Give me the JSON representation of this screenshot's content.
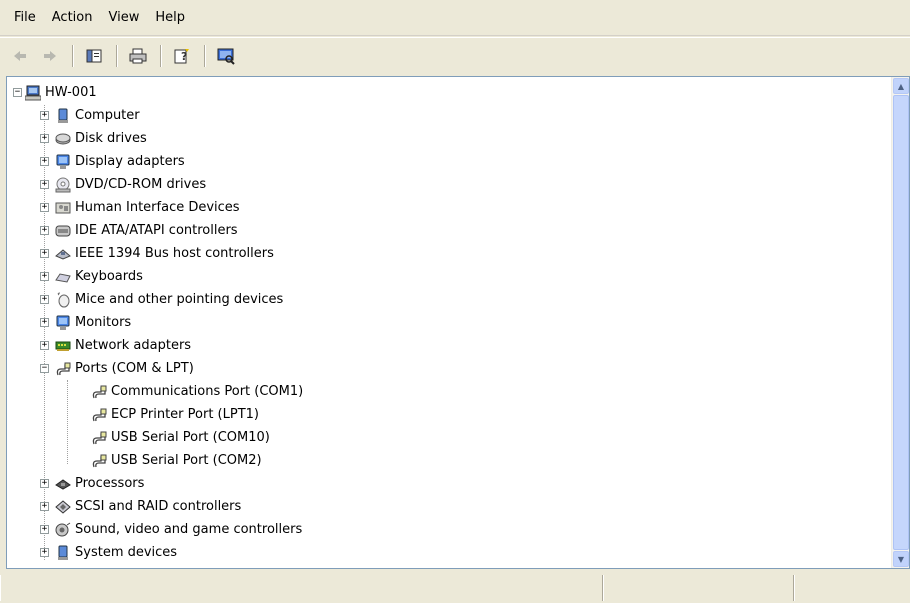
{
  "menubar": {
    "items": [
      {
        "label": "File"
      },
      {
        "label": "Action"
      },
      {
        "label": "View"
      },
      {
        "label": "Help"
      }
    ]
  },
  "toolbar": {
    "buttons": [
      "back-arrow-icon",
      "forward-arrow-icon",
      "show-hide-console-tree-icon",
      "print-icon",
      "properties-help-icon",
      "scan-hardware-icon"
    ]
  },
  "tree": {
    "root": {
      "label": "HW-001",
      "expander": "−"
    },
    "items": [
      {
        "label": "Computer",
        "expander": "+"
      },
      {
        "label": "Disk drives",
        "expander": "+"
      },
      {
        "label": "Display adapters",
        "expander": "+"
      },
      {
        "label": "DVD/CD-ROM drives",
        "expander": "+"
      },
      {
        "label": "Human Interface Devices",
        "expander": "+"
      },
      {
        "label": "IDE ATA/ATAPI controllers",
        "expander": "+"
      },
      {
        "label": "IEEE 1394 Bus host controllers",
        "expander": "+"
      },
      {
        "label": "Keyboards",
        "expander": "+"
      },
      {
        "label": "Mice and other pointing devices",
        "expander": "+"
      },
      {
        "label": "Monitors",
        "expander": "+"
      },
      {
        "label": "Network adapters",
        "expander": "+"
      },
      {
        "label": "Ports (COM & LPT)",
        "expander": "−"
      },
      {
        "label": "Processors",
        "expander": "+"
      },
      {
        "label": "SCSI and RAID controllers",
        "expander": "+"
      },
      {
        "label": "Sound, video and game controllers",
        "expander": "+"
      },
      {
        "label": "System devices",
        "expander": "+"
      }
    ],
    "ports_children": [
      {
        "label": "Communications Port (COM1)"
      },
      {
        "label": "ECP Printer Port (LPT1)"
      },
      {
        "label": "USB Serial Port (COM10)"
      },
      {
        "label": "USB Serial Port (COM2)"
      }
    ]
  },
  "scrollbar": {
    "up": "▲",
    "down": "▼"
  }
}
